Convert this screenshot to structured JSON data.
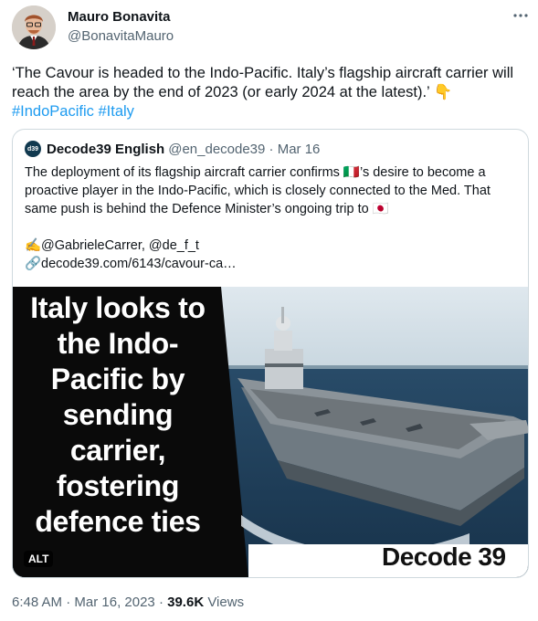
{
  "tweet": {
    "author_name": "Mauro Bonavita",
    "author_handle": "@BonavitaMauro",
    "text": "‘The Cavour is headed to the Indo-Pacific. Italy’s flagship aircraft carrier will reach the area by the end of 2023 (or early 2024 at the latest).’ 👇",
    "hashtags": [
      "#IndoPacific",
      "#Italy"
    ],
    "time": "6:48 AM",
    "date": "Mar 16, 2023",
    "views_count": "39.6K",
    "views_label": "Views"
  },
  "quote": {
    "avatar_text": "d39",
    "name": "Decode39 English",
    "handle": "@en_decode39",
    "date": "Mar 16",
    "text_line1": "The deployment of its flagship aircraft carrier confirms 🇮🇹’s desire to become a proactive player in the Indo-Pacific, which is closely connected to the Med. That same push is behind the Defence Minister’s ongoing trip to 🇯🇵",
    "credits": "✍️@GabrieleCarrer, @de_f_t",
    "link": "🔗decode39.com/6143/cavour-ca…",
    "media": {
      "overlay_text": "Italy looks to the Indo-Pacific by sending carrier, fostering defence ties",
      "brand": "Decode 39",
      "alt_label": "ALT"
    }
  },
  "icons": {
    "more": "more-dots-icon"
  },
  "colors": {
    "accent": "#1d9bf0",
    "secondary_text": "#536471",
    "border": "#cfd9de"
  }
}
